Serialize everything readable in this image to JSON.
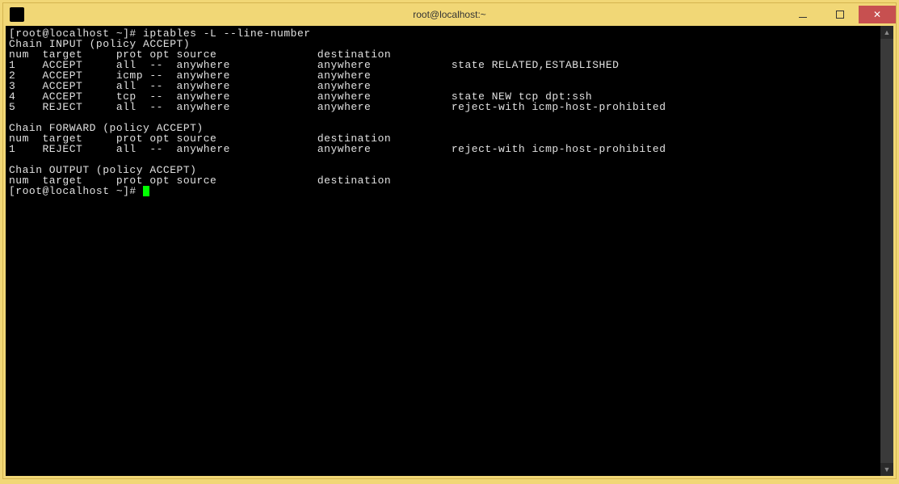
{
  "window": {
    "title": "root@localhost:~"
  },
  "terminal": {
    "prompt1": "[root@localhost ~]# ",
    "command1": "iptables -L --line-number",
    "chain_input_header": "Chain INPUT (policy ACCEPT)",
    "columns_header": "num  target     prot opt source               destination         ",
    "input_rules": [
      "1    ACCEPT     all  --  anywhere             anywhere            state RELATED,ESTABLISHED ",
      "2    ACCEPT     icmp --  anywhere             anywhere            ",
      "3    ACCEPT     all  --  anywhere             anywhere            ",
      "4    ACCEPT     tcp  --  anywhere             anywhere            state NEW tcp dpt:ssh ",
      "5    REJECT     all  --  anywhere             anywhere            reject-with icmp-host-prohibited "
    ],
    "chain_forward_header": "Chain FORWARD (policy ACCEPT)",
    "forward_rules": [
      "1    REJECT     all  --  anywhere             anywhere            reject-with icmp-host-prohibited "
    ],
    "chain_output_header": "Chain OUTPUT (policy ACCEPT)",
    "output_columns": "num  target     prot opt source               destination         ",
    "prompt2": "[root@localhost ~]# "
  }
}
